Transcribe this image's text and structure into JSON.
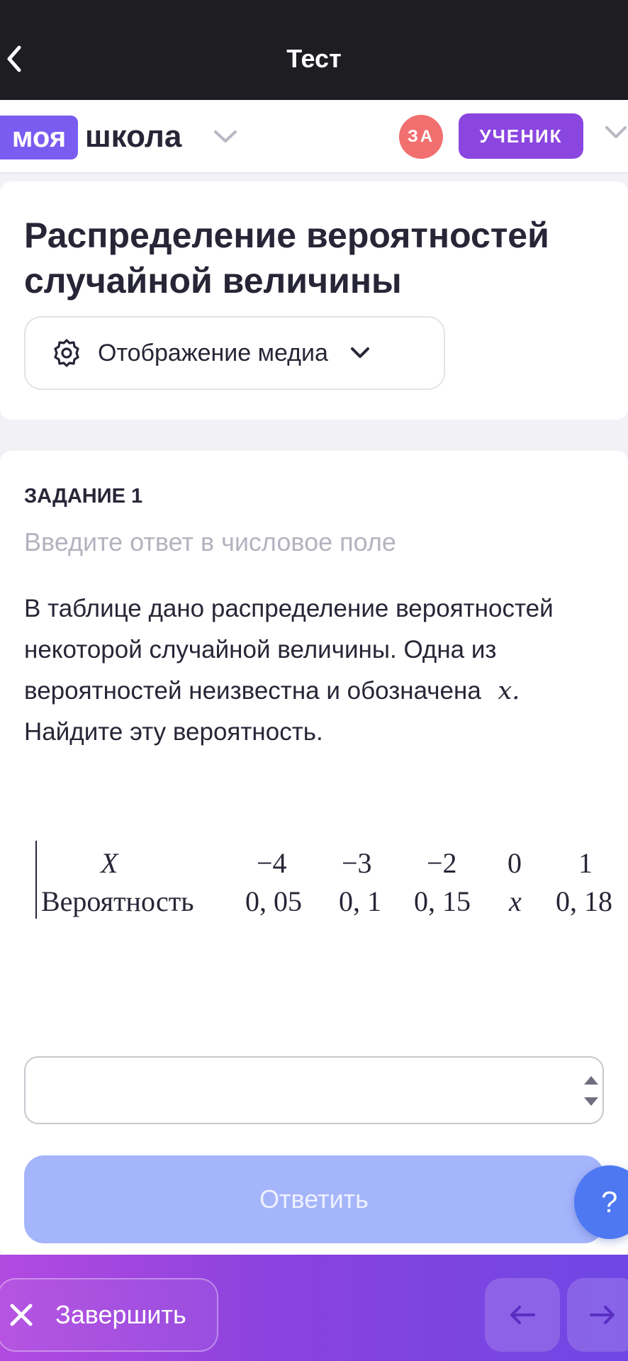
{
  "topbar": {
    "title": "Тест"
  },
  "brand": {
    "moya": "моя",
    "school": "школа"
  },
  "user": {
    "initials": "ЗА",
    "role": "УЧЕНИК"
  },
  "header": {
    "title": "Распределение вероятностей случайной величины",
    "media_label": "Отображение медиа"
  },
  "task": {
    "label": "ЗАДАНИЕ 1",
    "hint": "Введите ответ в числовое поле",
    "text_before": "В таблице дано распределение вероятностей некоторой случайной величины. Одна из вероятностей неизвестна и обозначена",
    "variable": "x.",
    "text_after": "Найдите эту вероятность.",
    "table": {
      "row1_header": "X",
      "row2_header": "Вероятность",
      "values": [
        "−4",
        "−3",
        "−2",
        "0",
        "1"
      ],
      "probabilities": [
        "0, 05",
        "0, 1",
        "0, 15",
        "x",
        "0, 18"
      ]
    },
    "answer_value": "",
    "submit_label": "Ответить"
  },
  "help": {
    "label": "?"
  },
  "footer": {
    "finish_label": "Завершить"
  },
  "icons": {
    "back": "chevron-left-icon",
    "gear": "gear-icon",
    "dropdown": "chevron-down-icon",
    "close": "close-icon",
    "prev": "arrow-left-icon",
    "next": "arrow-right-icon",
    "spinner": "spinner-arrows-icon"
  },
  "colors": {
    "accent": "#7b5cf0",
    "role": "#8b46e0",
    "avatar": "#f26f6f",
    "submit": "#a5b5fb",
    "help": "#4e78f2"
  }
}
